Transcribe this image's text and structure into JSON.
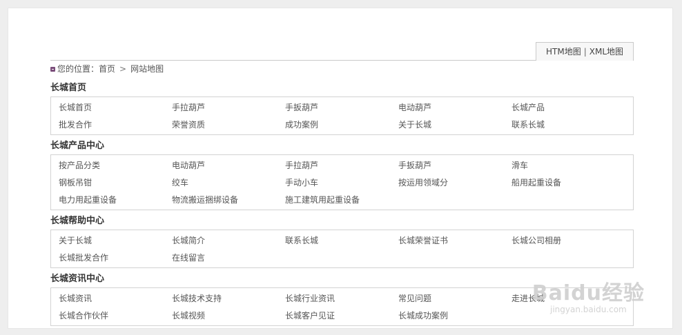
{
  "map_switch": {
    "htm_label": "HTM地图",
    "separator": "|",
    "xml_label": "XML地图"
  },
  "breadcrumb": {
    "prefix": "您的位置：",
    "home": "首页",
    "arrow": ">",
    "current": "网站地图"
  },
  "sections": [
    {
      "title": "长城首页",
      "links": [
        "长城首页",
        "手拉葫芦",
        "手扳葫芦",
        "电动葫芦",
        "长城产品",
        "批发合作",
        "荣誉资质",
        "成功案例",
        "关于长城",
        "联系长城"
      ]
    },
    {
      "title": "长城产品中心",
      "links": [
        "按产品分类",
        "电动葫芦",
        "手拉葫芦",
        "手扳葫芦",
        "滑车",
        "钢板吊钳",
        "绞车",
        "手动小车",
        "按运用领域分",
        "船用起重设备",
        "电力用起重设备",
        "物流搬运捆绑设备",
        "施工建筑用起重设备"
      ]
    },
    {
      "title": "长城帮助中心",
      "links": [
        "关于长城",
        "长城简介",
        "联系长城",
        "长城荣誉证书",
        "长城公司相册",
        "长城批发合作",
        "在线留言"
      ]
    },
    {
      "title": "长城资讯中心",
      "links": [
        "长城资讯",
        "长城技术支持",
        "长城行业资讯",
        "常见问题",
        "走进长城",
        "长城合作伙伴",
        "长城视频",
        "长城客户见证",
        "长城成功案例"
      ]
    }
  ],
  "watermark": {
    "main": "Baidu经验",
    "sub": "jingyan.baidu.com"
  }
}
